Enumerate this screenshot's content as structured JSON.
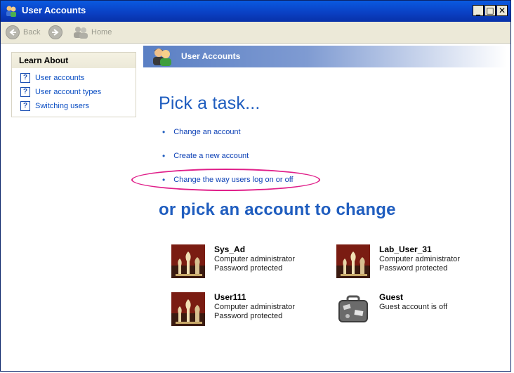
{
  "window": {
    "title": "User Accounts",
    "controls": [
      "_",
      "□",
      "✕"
    ]
  },
  "toolbar": {
    "back_label": "Back",
    "forward_label": "",
    "home_label": "Home"
  },
  "learn_about": {
    "heading": "Learn About",
    "items": [
      {
        "label": "User accounts"
      },
      {
        "label": "User account types"
      },
      {
        "label": "Switching users"
      }
    ]
  },
  "banner": {
    "title": "User Accounts"
  },
  "tasks": {
    "heading": "Pick a task...",
    "items": [
      {
        "label": "Change an account"
      },
      {
        "label": "Create a new account"
      },
      {
        "label": "Change the way users log on or off",
        "highlighted": true
      }
    ]
  },
  "accounts": {
    "heading": "or pick an account to change",
    "items": [
      {
        "name": "Sys_Ad",
        "lines": [
          "Computer administrator",
          "Password protected"
        ],
        "picture": "chess-icon"
      },
      {
        "name": "Lab_User_31",
        "lines": [
          "Computer administrator",
          "Password protected"
        ],
        "picture": "chess-icon"
      },
      {
        "name": "User111",
        "lines": [
          "Computer administrator",
          "Password protected"
        ],
        "picture": "chess-icon"
      },
      {
        "name": "Guest",
        "lines": [
          "Guest account is off"
        ],
        "picture": "suitcase-icon"
      }
    ]
  },
  "colors": {
    "titlebar": "#0a3fc2",
    "heading_blue": "#1f5dbf",
    "link_blue": "#0b3fb5",
    "highlight_ellipse": "#e0208a"
  }
}
